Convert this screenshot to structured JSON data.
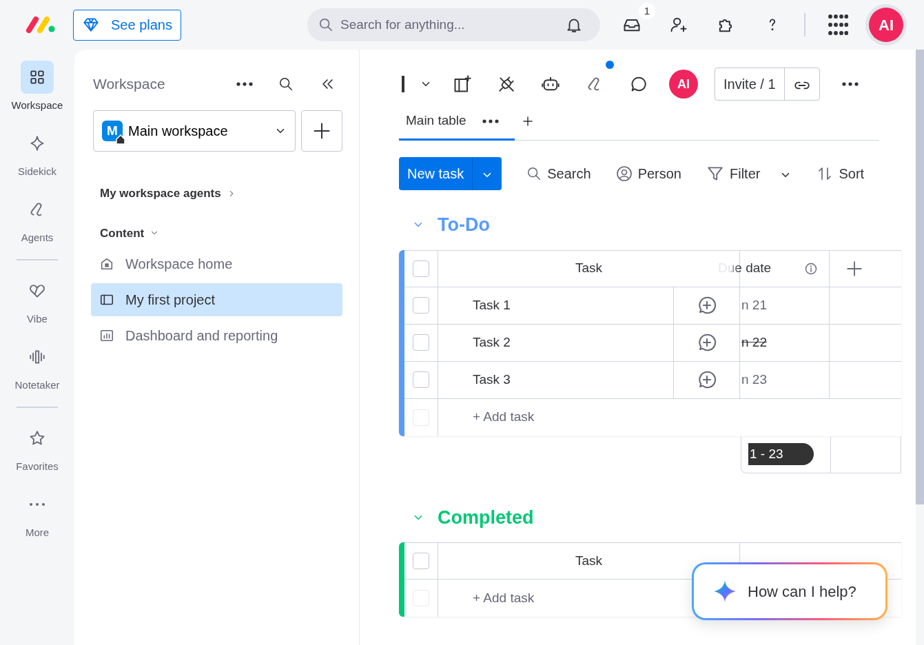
{
  "topbar": {
    "plans_button": "See plans",
    "search": {
      "placeholder": "Search for anything..."
    },
    "inbox_badge": "1",
    "avatar": "AI"
  },
  "rail": [
    {
      "label": "Workspace",
      "selected": true
    },
    {
      "label": "Sidekick",
      "selected": false
    },
    {
      "label": "Agents",
      "selected": false
    },
    {
      "label": "Vibe",
      "selected": false
    },
    {
      "label": "Notetaker",
      "selected": false
    },
    {
      "label": "Favorites",
      "selected": false
    },
    {
      "label": "More",
      "selected": false
    }
  ],
  "workspace_panel": {
    "title": "Workspace",
    "selector": {
      "letter": "M",
      "value": "Main workspace"
    },
    "agents_link": "My workspace agents",
    "section": "Content",
    "items": [
      {
        "label": "Workspace home",
        "selected": false
      },
      {
        "label": "My first project",
        "selected": true
      },
      {
        "label": "Dashboard and reporting",
        "selected": false
      }
    ]
  },
  "board": {
    "avatar": "AI",
    "invite": "Invite / 1",
    "tabs": [
      {
        "label": "Main table",
        "selected": true
      }
    ],
    "new_task": "New task",
    "actions": [
      "Search",
      "Person",
      "Filter",
      "Sort"
    ],
    "groups": [
      {
        "title": "To-Do",
        "color": "#579bfc",
        "columns": [
          "Task",
          "Due date"
        ],
        "select_all_checked": false,
        "rows": [
          {
            "task": "Task 1",
            "date": "n 21",
            "strikethrough": false,
            "checked": false
          },
          {
            "task": "Task 2",
            "date": "n 22",
            "strikethrough": true,
            "checked": false
          },
          {
            "task": "Task 3",
            "date": "n 23",
            "strikethrough": false,
            "checked": false
          }
        ],
        "add_task": "+ Add task",
        "add_row_checked": false,
        "summary": "1 - 23"
      },
      {
        "title": "Completed",
        "color": "#00c875",
        "columns": [
          "Task"
        ],
        "select_all_checked": false,
        "add_task": "+ Add task",
        "add_row_checked": false
      }
    ]
  },
  "assistant": {
    "prompt": "How can I help?"
  }
}
